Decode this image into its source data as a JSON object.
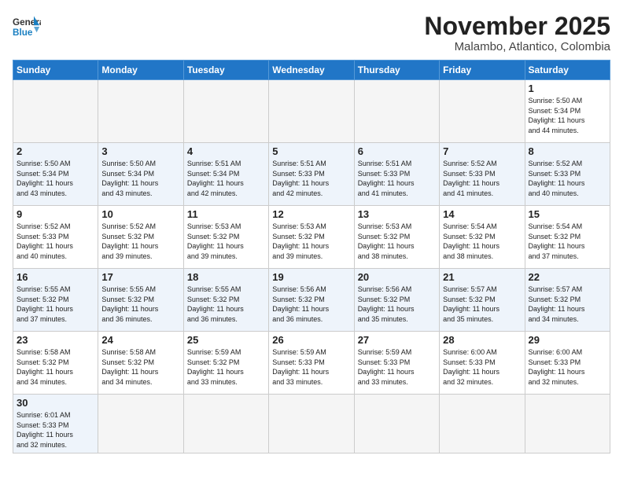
{
  "header": {
    "logo_general": "General",
    "logo_blue": "Blue",
    "title": "November 2025",
    "subtitle": "Malambo, Atlantico, Colombia"
  },
  "weekdays": [
    "Sunday",
    "Monday",
    "Tuesday",
    "Wednesday",
    "Thursday",
    "Friday",
    "Saturday"
  ],
  "weeks": [
    [
      {
        "day": "",
        "info": ""
      },
      {
        "day": "",
        "info": ""
      },
      {
        "day": "",
        "info": ""
      },
      {
        "day": "",
        "info": ""
      },
      {
        "day": "",
        "info": ""
      },
      {
        "day": "",
        "info": ""
      },
      {
        "day": "1",
        "info": "Sunrise: 5:50 AM\nSunset: 5:34 PM\nDaylight: 11 hours\nand 44 minutes."
      }
    ],
    [
      {
        "day": "2",
        "info": "Sunrise: 5:50 AM\nSunset: 5:34 PM\nDaylight: 11 hours\nand 43 minutes."
      },
      {
        "day": "3",
        "info": "Sunrise: 5:50 AM\nSunset: 5:34 PM\nDaylight: 11 hours\nand 43 minutes."
      },
      {
        "day": "4",
        "info": "Sunrise: 5:51 AM\nSunset: 5:34 PM\nDaylight: 11 hours\nand 42 minutes."
      },
      {
        "day": "5",
        "info": "Sunrise: 5:51 AM\nSunset: 5:33 PM\nDaylight: 11 hours\nand 42 minutes."
      },
      {
        "day": "6",
        "info": "Sunrise: 5:51 AM\nSunset: 5:33 PM\nDaylight: 11 hours\nand 41 minutes."
      },
      {
        "day": "7",
        "info": "Sunrise: 5:52 AM\nSunset: 5:33 PM\nDaylight: 11 hours\nand 41 minutes."
      },
      {
        "day": "8",
        "info": "Sunrise: 5:52 AM\nSunset: 5:33 PM\nDaylight: 11 hours\nand 40 minutes."
      }
    ],
    [
      {
        "day": "9",
        "info": "Sunrise: 5:52 AM\nSunset: 5:33 PM\nDaylight: 11 hours\nand 40 minutes."
      },
      {
        "day": "10",
        "info": "Sunrise: 5:52 AM\nSunset: 5:32 PM\nDaylight: 11 hours\nand 39 minutes."
      },
      {
        "day": "11",
        "info": "Sunrise: 5:53 AM\nSunset: 5:32 PM\nDaylight: 11 hours\nand 39 minutes."
      },
      {
        "day": "12",
        "info": "Sunrise: 5:53 AM\nSunset: 5:32 PM\nDaylight: 11 hours\nand 39 minutes."
      },
      {
        "day": "13",
        "info": "Sunrise: 5:53 AM\nSunset: 5:32 PM\nDaylight: 11 hours\nand 38 minutes."
      },
      {
        "day": "14",
        "info": "Sunrise: 5:54 AM\nSunset: 5:32 PM\nDaylight: 11 hours\nand 38 minutes."
      },
      {
        "day": "15",
        "info": "Sunrise: 5:54 AM\nSunset: 5:32 PM\nDaylight: 11 hours\nand 37 minutes."
      }
    ],
    [
      {
        "day": "16",
        "info": "Sunrise: 5:55 AM\nSunset: 5:32 PM\nDaylight: 11 hours\nand 37 minutes."
      },
      {
        "day": "17",
        "info": "Sunrise: 5:55 AM\nSunset: 5:32 PM\nDaylight: 11 hours\nand 36 minutes."
      },
      {
        "day": "18",
        "info": "Sunrise: 5:55 AM\nSunset: 5:32 PM\nDaylight: 11 hours\nand 36 minutes."
      },
      {
        "day": "19",
        "info": "Sunrise: 5:56 AM\nSunset: 5:32 PM\nDaylight: 11 hours\nand 36 minutes."
      },
      {
        "day": "20",
        "info": "Sunrise: 5:56 AM\nSunset: 5:32 PM\nDaylight: 11 hours\nand 35 minutes."
      },
      {
        "day": "21",
        "info": "Sunrise: 5:57 AM\nSunset: 5:32 PM\nDaylight: 11 hours\nand 35 minutes."
      },
      {
        "day": "22",
        "info": "Sunrise: 5:57 AM\nSunset: 5:32 PM\nDaylight: 11 hours\nand 34 minutes."
      }
    ],
    [
      {
        "day": "23",
        "info": "Sunrise: 5:58 AM\nSunset: 5:32 PM\nDaylight: 11 hours\nand 34 minutes."
      },
      {
        "day": "24",
        "info": "Sunrise: 5:58 AM\nSunset: 5:32 PM\nDaylight: 11 hours\nand 34 minutes."
      },
      {
        "day": "25",
        "info": "Sunrise: 5:59 AM\nSunset: 5:32 PM\nDaylight: 11 hours\nand 33 minutes."
      },
      {
        "day": "26",
        "info": "Sunrise: 5:59 AM\nSunset: 5:33 PM\nDaylight: 11 hours\nand 33 minutes."
      },
      {
        "day": "27",
        "info": "Sunrise: 5:59 AM\nSunset: 5:33 PM\nDaylight: 11 hours\nand 33 minutes."
      },
      {
        "day": "28",
        "info": "Sunrise: 6:00 AM\nSunset: 5:33 PM\nDaylight: 11 hours\nand 32 minutes."
      },
      {
        "day": "29",
        "info": "Sunrise: 6:00 AM\nSunset: 5:33 PM\nDaylight: 11 hours\nand 32 minutes."
      }
    ],
    [
      {
        "day": "30",
        "info": "Sunrise: 6:01 AM\nSunset: 5:33 PM\nDaylight: 11 hours\nand 32 minutes."
      },
      {
        "day": "",
        "info": ""
      },
      {
        "day": "",
        "info": ""
      },
      {
        "day": "",
        "info": ""
      },
      {
        "day": "",
        "info": ""
      },
      {
        "day": "",
        "info": ""
      },
      {
        "day": "",
        "info": ""
      }
    ]
  ]
}
